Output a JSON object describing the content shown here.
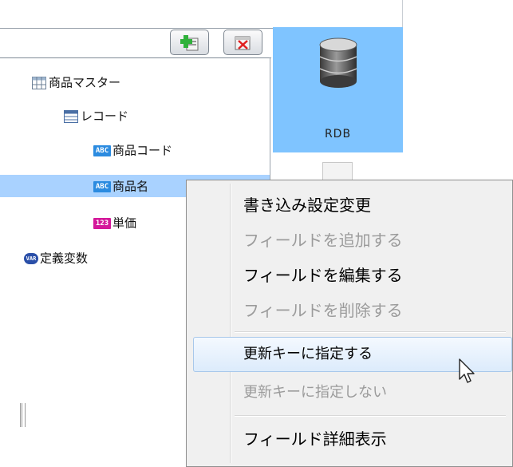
{
  "toolbar": {
    "add_icon": "add-field-icon",
    "delete_icon": "delete-field-icon"
  },
  "connector": {
    "label": "RDB",
    "icon": "database-icon",
    "accent": "#7fc4ff"
  },
  "tree": {
    "items": [
      {
        "label": "商品マスター",
        "icon": "table-icon"
      },
      {
        "label": "レコード",
        "icon": "record-icon"
      },
      {
        "label": "商品コード",
        "icon": "abc-badge-icon",
        "badge": "ABC"
      },
      {
        "label": "商品名",
        "icon": "abc-badge-icon",
        "badge": "ABC",
        "selected": true
      },
      {
        "label": "単価",
        "icon": "number-badge-icon",
        "badge": "123"
      },
      {
        "label": "定義変数",
        "icon": "var-badge-icon",
        "badge": "VAR"
      }
    ],
    "selected_color": "#a9d2ff"
  },
  "context_menu": {
    "items": [
      {
        "label": "書き込み設定変更",
        "enabled": true
      },
      {
        "label": "フィールドを追加する",
        "enabled": false
      },
      {
        "label": "フィールドを編集する",
        "enabled": true
      },
      {
        "label": "フィールドを削除する",
        "enabled": false
      },
      {
        "label": "更新キーに指定する",
        "enabled": true,
        "hovered": true
      },
      {
        "label": "更新キーに指定しない",
        "enabled": false
      },
      {
        "label": "フィールド詳細表示",
        "enabled": true
      }
    ]
  }
}
